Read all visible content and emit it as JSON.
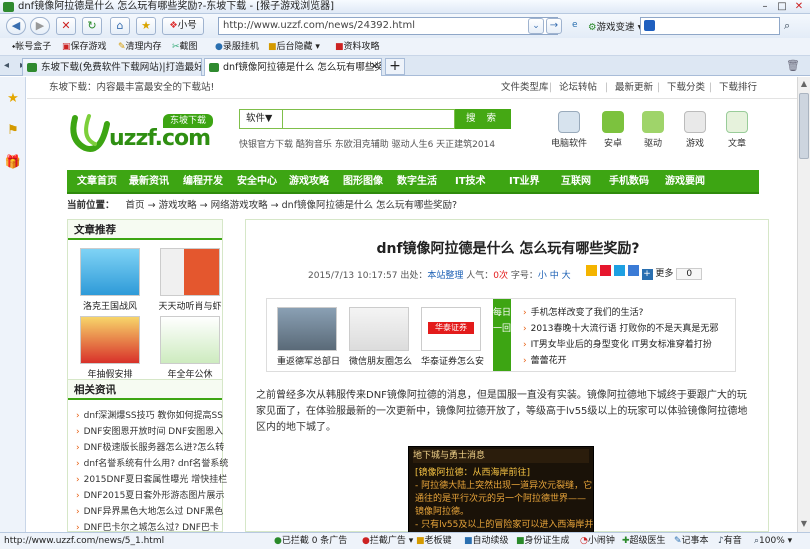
{
  "browser": {
    "title": "dnf镜像阿拉德是什么 怎么玩有哪些奖励?-东坡下载 - [猴子游戏浏览器]",
    "small_label": "小号",
    "address": "http://www.uzzf.com/news/24392.html",
    "speed_label": "游戏变速",
    "favorites": [
      "帐号盒子",
      "保存游戏",
      "清理内存",
      "截图",
      "录服挂机",
      "后台隐藏",
      "资料攻略"
    ],
    "tabs": [
      {
        "label": "东坡下载(免费软件下载网站)|打造最好"
      },
      {
        "label": "dnf镜像阿拉德是什么 怎么玩有哪些奖"
      }
    ],
    "status": {
      "url": "http://www.uzzf.com/news/5_1.html",
      "items": [
        "已拦截 0 条广告",
        "拦截广告",
        "老板键",
        "自动续级",
        "身份证生成",
        "小闹钟",
        "超级医生",
        "记事本",
        "有音",
        "100%"
      ]
    }
  },
  "site": {
    "tagline": "东坡下载：内容最丰富最安全的下载站!",
    "top_links": [
      "文件类型库",
      "论坛转帖",
      "最新更新",
      "下载分类",
      "下载排行"
    ],
    "logo_text": "uzzf.com",
    "logo_badge": "东坡下载",
    "search": {
      "category": "软件▼",
      "button": "搜 索"
    },
    "hot_links": "快银官方下载  酷狗音乐  东欧泪克辅助  驱动人生6  天正建筑2014",
    "top_icons": [
      "电脑软件",
      "安卓",
      "驱动",
      "游戏",
      "文章"
    ],
    "nav": [
      "文章首页",
      "最新资讯",
      "编程开发",
      "安全中心",
      "游戏攻略",
      "图形图像",
      "数字生活",
      "IT技术",
      "IT业界",
      "互联网",
      "手机数码",
      "游戏要闻"
    ],
    "breadcrumb": {
      "label": "当前位置：",
      "items": [
        "首页",
        "游戏攻略",
        "网络游戏攻略",
        "dnf镜像阿拉德是什么 怎么玩有哪些奖励?"
      ]
    },
    "recommend": {
      "title": "文章推荐",
      "items": [
        "洛克王国战风",
        "天天动听肖与虾",
        "年抽假安排",
        "年全年公休"
      ]
    },
    "related": {
      "title": "相关资讯",
      "items": [
        "dnf深渊爆SS技巧 教你如何提高SS",
        "DNF安图恩开放时间 DNF安图恩入",
        "DNF极速版长服务器怎么进?怎么转",
        "dnf名誉系统有什么用? dnf名誉系统",
        "2015DNF夏日套属性曝光 增快挂栏",
        "DNF2015夏日套外形游态图片展示",
        "DNF异界黑色大地怎么过 DNF黑色",
        "DNF巴卡尔之城怎么过? DNF巴卡"
      ]
    },
    "article": {
      "title": "dnf镜像阿拉德是什么  怎么玩有哪些奖励?",
      "date": "2015/7/13 10:17:57",
      "source_label": "出处：",
      "source": "本站整理",
      "views_label": "人气：",
      "views": "0次",
      "font_label": "字号：",
      "font_sizes": [
        "小",
        "中",
        "大"
      ],
      "share_label": "更多",
      "share_count": "0",
      "daily": {
        "label": "每日一回",
        "thumbs": [
          "重返德军总部日",
          "微信朋友圈怎么",
          "华泰证券怎么安"
        ],
        "thumb_badge": "华泰证券",
        "items": [
          "手机怎样改变了我们的生活?",
          "2013春晚十大流行语 打败你的不是天真是无邪",
          "IT男女毕业后的身型变化 IT男女标准穿着打扮",
          "蕾蕾花开"
        ]
      },
      "paragraph": "之前曾经多次从韩服传来DNF镜像阿拉德的消息，但是国服一直没有实装。镜像阿拉德地下城终于要跟广大的玩家见面了，在体验服最新的一次更新中，镜像阿拉德开放了，等级高于lv55级以上的玩家可以体验镜像阿拉德地区内的地下城了。",
      "game_image": {
        "header": "地下城与勇士消息",
        "lines": [
          "[镜像阿拉德：从西海岸前往]",
          "- 阿拉德大陆上突然出现一道异次元裂缝，它",
          "通往的是平行次元的另一个阿拉德世界——",
          "镜像阿拉德。",
          "- 只有lv55及以上的冒险家可以进入西海岸并"
        ]
      }
    }
  }
}
